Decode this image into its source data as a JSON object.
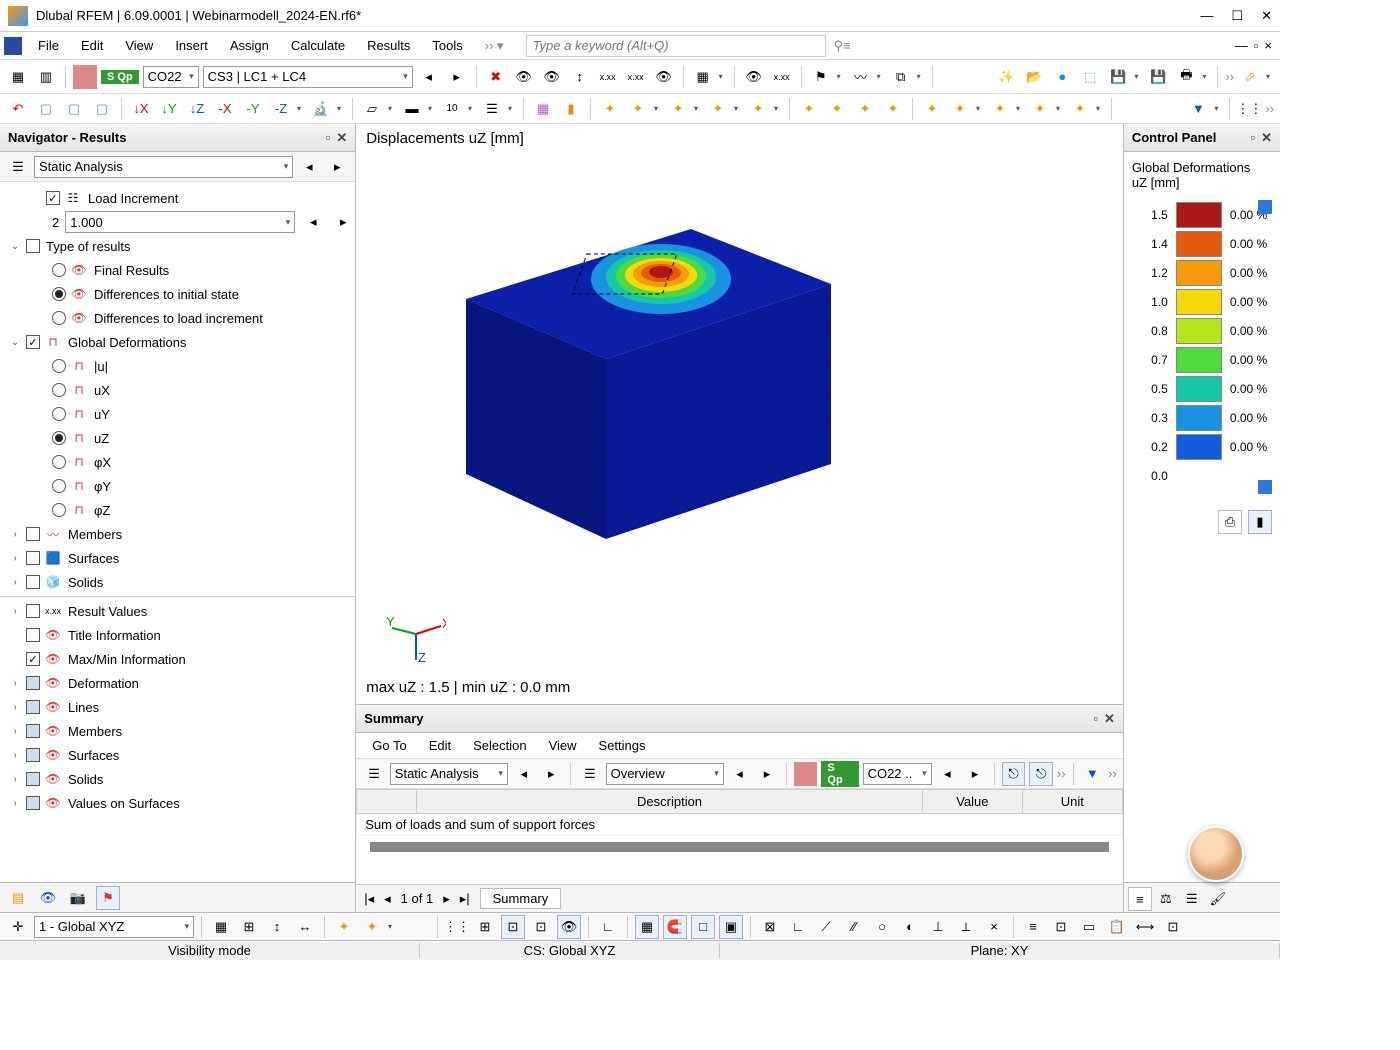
{
  "window": {
    "title": "Dlubal RFEM | 6.09.0001 | Webinarmodell_2024-EN.rf6*"
  },
  "menu": {
    "items": [
      "File",
      "Edit",
      "View",
      "Insert",
      "Assign",
      "Calculate",
      "Results",
      "Tools"
    ],
    "search_placeholder": "Type a keyword (Alt+Q)"
  },
  "toolbar1": {
    "badge_label": "S Qp",
    "combo_lc": "CO22",
    "combo_cs": "CS3 | LC1 + LC4"
  },
  "navigator": {
    "title": "Navigator - Results",
    "combo": "Static Analysis",
    "load_increment": {
      "label": "Load Increment",
      "idx": "2",
      "val": "1.000"
    },
    "type_of_results": {
      "label": "Type of results",
      "items": [
        "Final Results",
        "Differences to initial state",
        "Differences to load increment"
      ],
      "selected": 1
    },
    "global_def": {
      "label": "Global Deformations",
      "items": [
        "|u|",
        "uX",
        "uY",
        "uZ",
        "φX",
        "φY",
        "φZ"
      ],
      "selected": 3
    },
    "groups": [
      "Members",
      "Surfaces",
      "Solids",
      "Result Values",
      "Title Information",
      "Max/Min Information",
      "Deformation",
      "Lines",
      "Members",
      "Surfaces",
      "Solids",
      "Values on Surfaces"
    ],
    "groups_checked": [
      false,
      false,
      false,
      false,
      false,
      true,
      null,
      null,
      null,
      null,
      null,
      null
    ],
    "groups_filled": [
      false,
      false,
      false,
      false,
      false,
      false,
      true,
      true,
      true,
      true,
      true,
      true
    ]
  },
  "viewport": {
    "label": "Displacements uZ  [mm]",
    "minmax": "max uZ : 1.5 | min uZ : 0.0 mm"
  },
  "control": {
    "title": "Control Panel",
    "heading": "Global Deformations",
    "unit": "uZ [mm]",
    "legend": [
      {
        "v": "1.5",
        "c": "#b01717",
        "p": "0.00 %"
      },
      {
        "v": "1.4",
        "c": "#e65b0b",
        "p": "0.00 %"
      },
      {
        "v": "1.2",
        "c": "#f59b0a",
        "p": "0.00 %"
      },
      {
        "v": "1.0",
        "c": "#f7d808",
        "p": "0.00 %"
      },
      {
        "v": "0.8",
        "c": "#b6e61a",
        "p": "0.00 %"
      },
      {
        "v": "0.7",
        "c": "#4ddb3e",
        "p": "0.00 %"
      },
      {
        "v": "0.5",
        "c": "#16c9a6",
        "p": "0.00 %"
      },
      {
        "v": "0.3",
        "c": "#1893e0",
        "p": "0.00 %"
      },
      {
        "v": "0.2",
        "c": "#125de0",
        "p": "0.00 %"
      },
      {
        "v": "0.0",
        "c": "#0b1fa8",
        "p": ""
      }
    ]
  },
  "summary": {
    "title": "Summary",
    "menu": [
      "Go To",
      "Edit",
      "Selection",
      "View",
      "Settings"
    ],
    "combo1": "Static Analysis",
    "combo2": "Overview",
    "badge": "S Qp",
    "combo3": "CO22  ..",
    "cols": [
      "",
      "Description",
      "Value",
      "Unit"
    ],
    "row1": "Sum of loads and sum of support forces",
    "pager": "1 of 1",
    "tab": "Summary"
  },
  "status": {
    "vis": "Visibility mode",
    "cs": "CS: Global XYZ",
    "plane": "Plane: XY"
  },
  "bottom": {
    "combo": "1 - Global XYZ"
  }
}
